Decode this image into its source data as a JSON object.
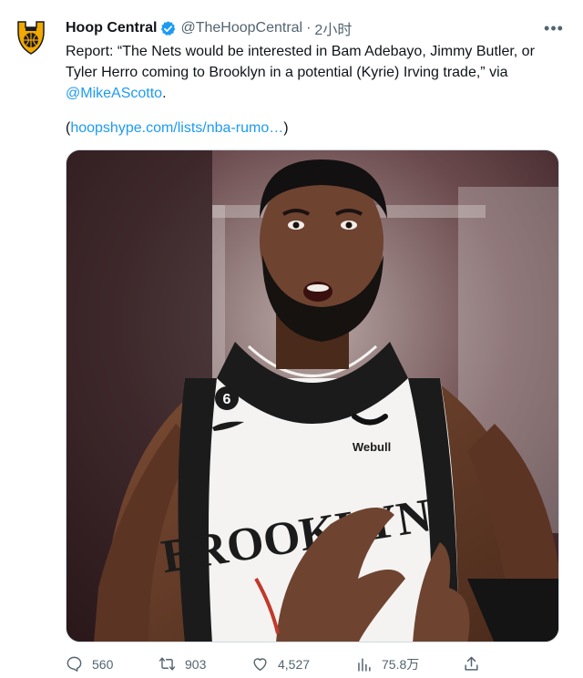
{
  "tweet": {
    "display_name": "Hoop Central",
    "handle": "@TheHoopCentral",
    "separator": "·",
    "time": "2小时",
    "more_label": "•••",
    "text_line_1": "Report: “The Nets would be interested in Bam Adebayo, Jimmy Butler, or",
    "text_line_2": "Tyler Herro coming to Brooklyn in a potential (Kyrie) Irving trade,” via",
    "mention": "@MikeAScotto",
    "mention_suffix": ".",
    "link_open": "(",
    "link_text": "hoopshype.com/lists/nba-rumo…",
    "link_close": ")",
    "media": {
      "jersey_text": "BROOKLYN",
      "jersey_number": "6",
      "sponsor": "Webull"
    }
  },
  "actions": {
    "reply_count": "560",
    "retweet_count": "903",
    "like_count": "4,527",
    "views_count": "75.8万"
  },
  "colors": {
    "accent": "#1d9bf0",
    "secondary_text": "#536471",
    "brand_gold": "#f2a900"
  },
  "icons": [
    "hoop-central-logo",
    "verified-badge-icon",
    "more-icon",
    "reply-icon",
    "retweet-icon",
    "like-icon",
    "views-icon",
    "share-icon"
  ]
}
